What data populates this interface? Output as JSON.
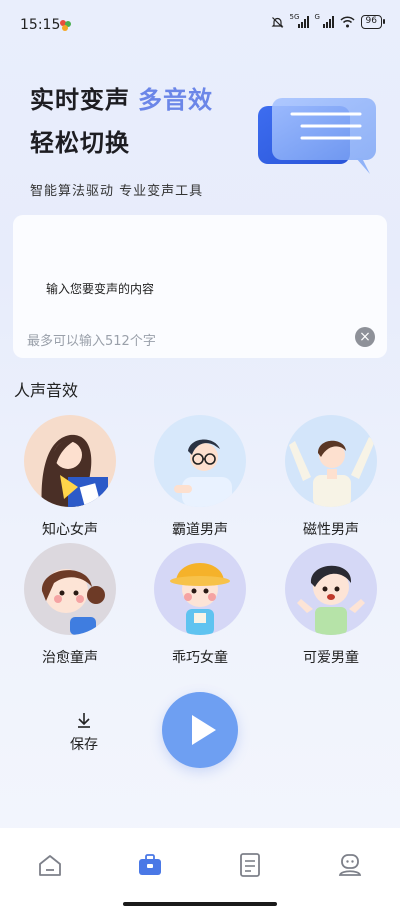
{
  "status_bar": {
    "time": "15:15",
    "signal1_label": "5G",
    "signal2_label": "G",
    "battery": "96"
  },
  "hero": {
    "title_part1": "实时变声",
    "title_accent": "多音效",
    "title_line2": "轻松切换",
    "subtitle": "智能算法驱动 专业变声工具"
  },
  "input": {
    "value": "输入您要变声的内容",
    "placeholder": "最多可以输入512个字"
  },
  "section_title": "人声音效",
  "voices": [
    {
      "label": "知心女声"
    },
    {
      "label": "霸道男声"
    },
    {
      "label": "磁性男声"
    },
    {
      "label": "治愈童声"
    },
    {
      "label": "乖巧女童"
    },
    {
      "label": "可爱男童"
    }
  ],
  "actions": {
    "save_label": "保存"
  },
  "tabs": [
    {
      "icon": "home-icon"
    },
    {
      "icon": "toolbox-icon",
      "active": true
    },
    {
      "icon": "document-icon"
    },
    {
      "icon": "profile-icon"
    }
  ],
  "colors": {
    "accent": "#6b86e8",
    "play": "#6e9ff2",
    "tab_active": "#4a78e6",
    "tab_inactive": "#7d8089"
  }
}
